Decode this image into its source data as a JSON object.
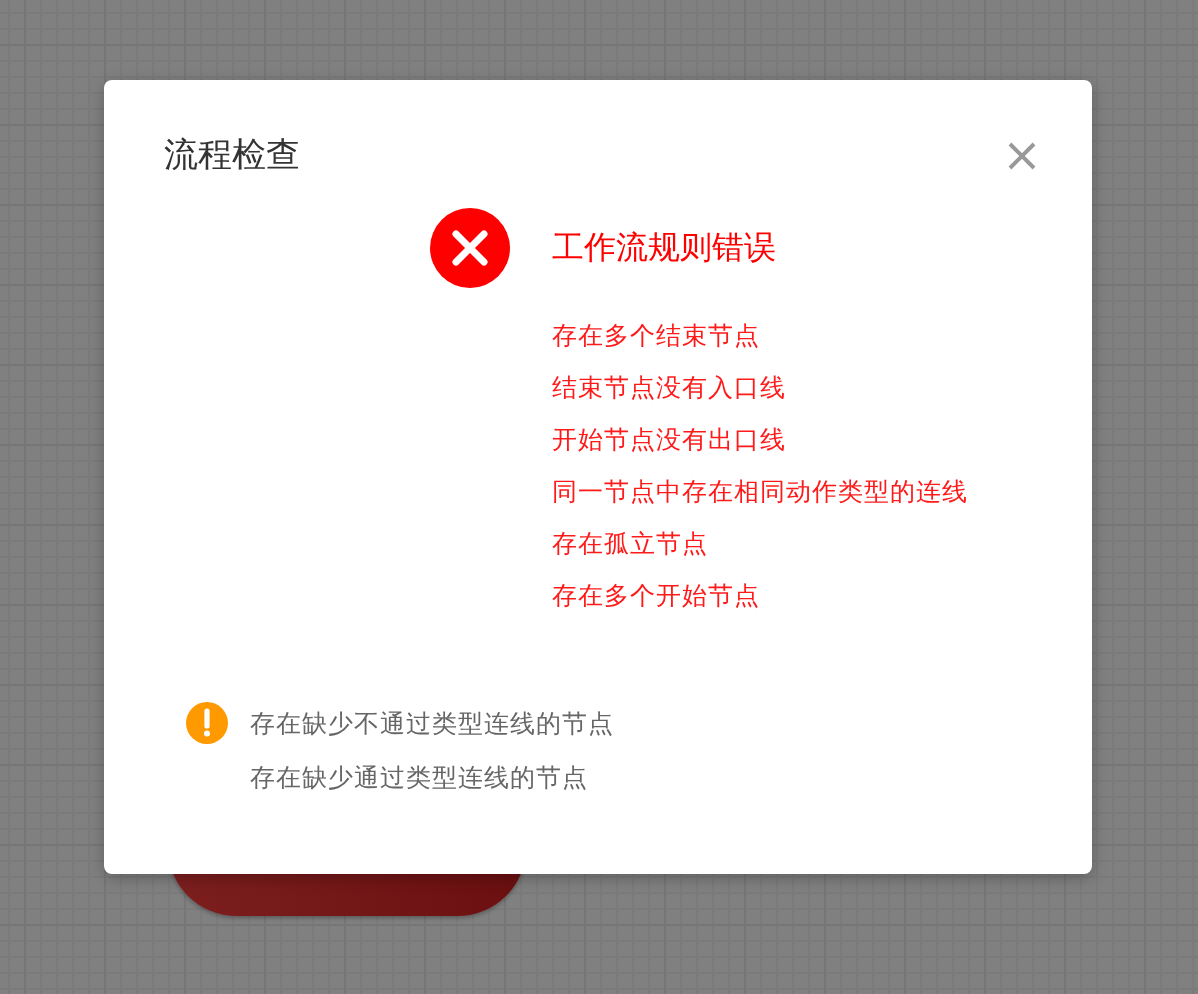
{
  "dialog": {
    "title": "流程检查",
    "error": {
      "heading": "工作流规则错误",
      "items": [
        "存在多个结束节点",
        "结束节点没有入口线",
        "开始节点没有出口线",
        "同一节点中存在相同动作类型的连线",
        "存在孤立节点",
        "存在多个开始节点"
      ]
    },
    "warning": {
      "items": [
        "存在缺少不通过类型连线的节点",
        "存在缺少通过类型连线的节点"
      ]
    }
  }
}
